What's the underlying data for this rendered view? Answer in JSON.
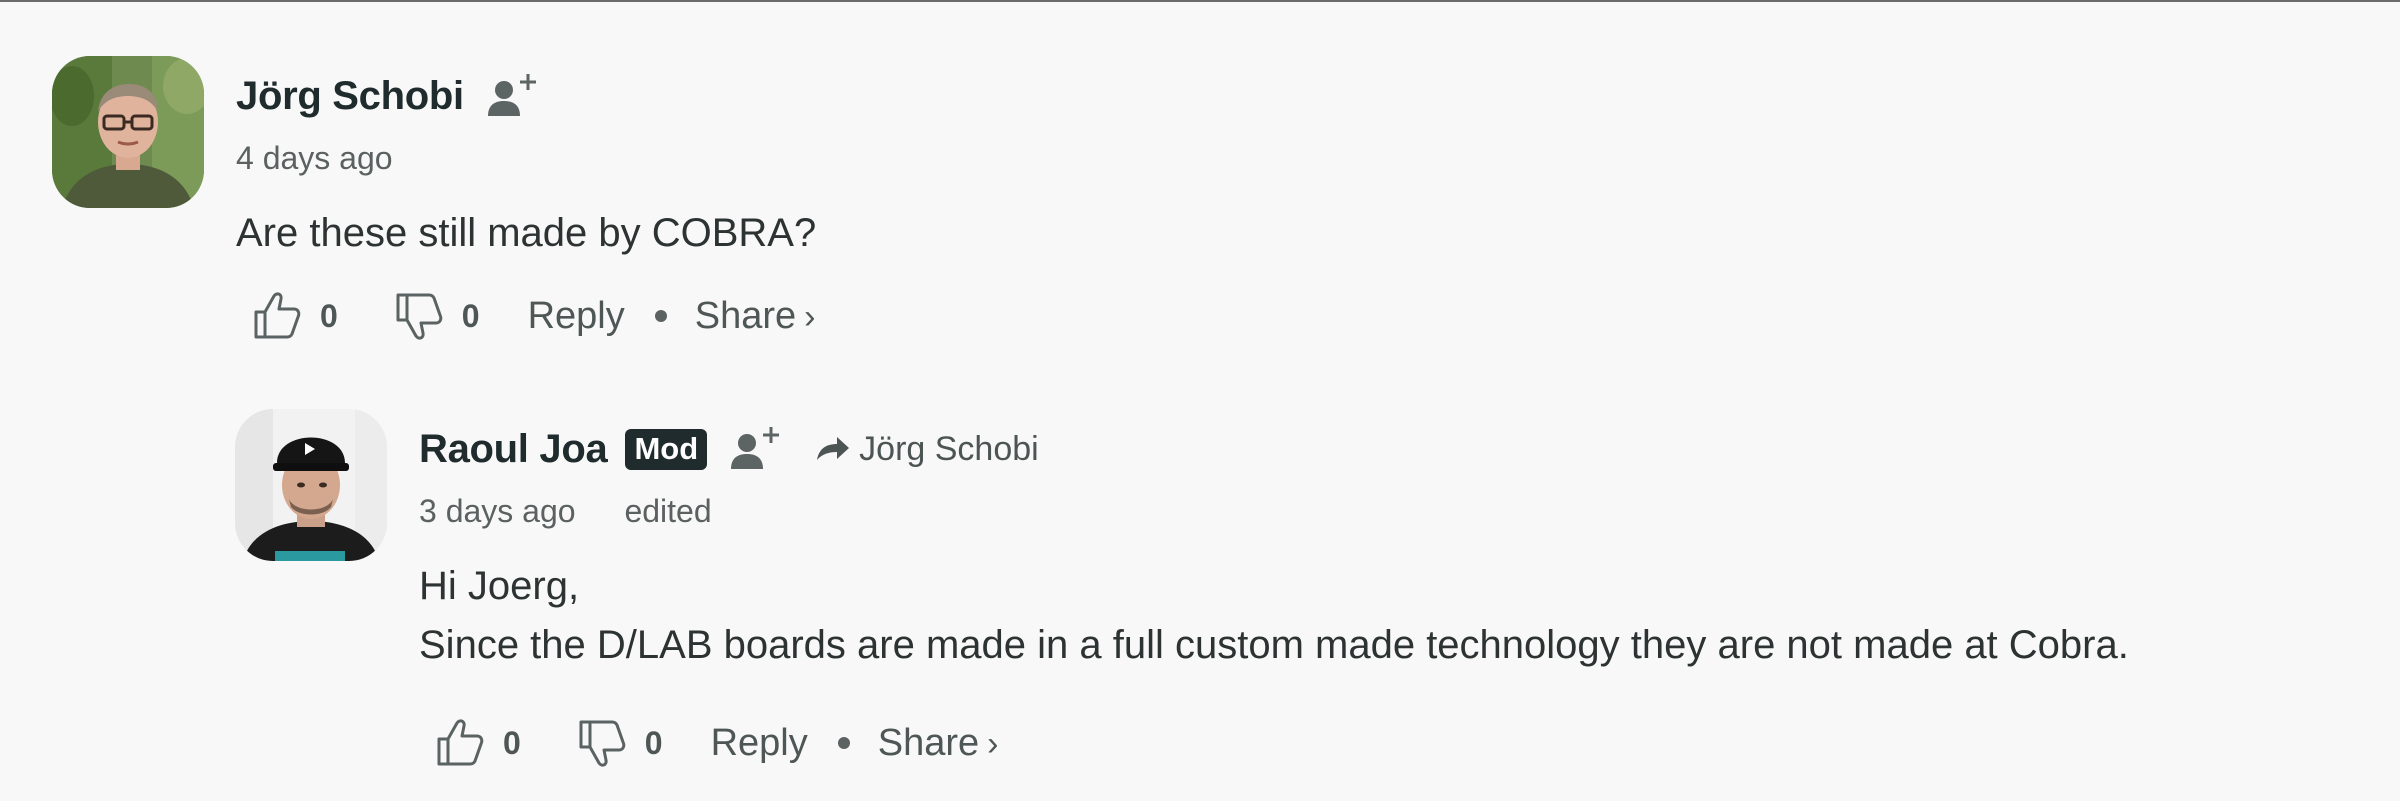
{
  "comments": [
    {
      "author": "Jörg Schobi",
      "timestamp": "4 days ago",
      "text_lines": [
        "Are these still made by COBRA?"
      ],
      "upvotes": "0",
      "downvotes": "0",
      "reply_label": "Reply",
      "share_label": "Share",
      "share_chevron": "›",
      "avatar_icon": "avatar-photo",
      "follow_icon": "follow-user-icon"
    },
    {
      "author": "Raoul Joa",
      "badge": "Mod",
      "reply_to": "Jörg Schobi",
      "timestamp": "3 days ago",
      "edited_label": "edited",
      "text_lines": [
        "Hi Joerg,",
        "Since the D/LAB boards are made in a full custom made technology they are not made at Cobra."
      ],
      "upvotes": "0",
      "downvotes": "0",
      "reply_label": "Reply",
      "share_label": "Share",
      "share_chevron": "›",
      "avatar_icon": "avatar-photo",
      "follow_icon": "follow-user-icon",
      "reply_to_icon": "reply-arrow-icon"
    }
  ],
  "colors": {
    "background": "#f8f8f8",
    "text_primary": "#1f2b2d",
    "text_secondary": "#5b6161",
    "badge_bg": "#1f2b2d",
    "badge_text": "#ffffff"
  }
}
